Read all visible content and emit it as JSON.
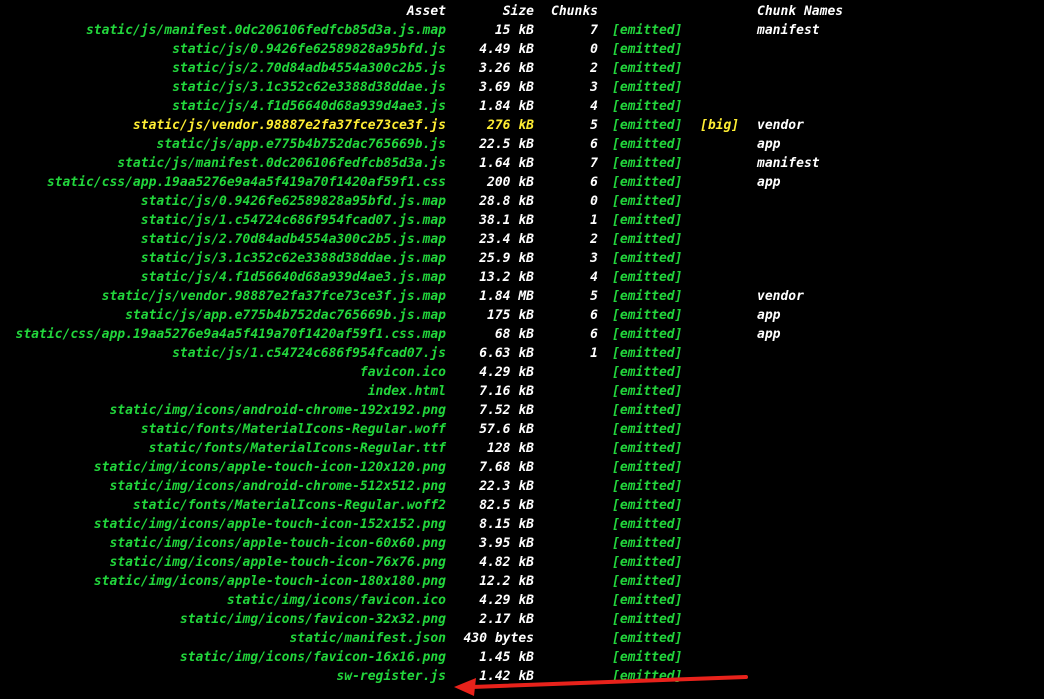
{
  "colors": {
    "background": "#000000",
    "asset_text": "#22d63c",
    "status_text": "#22d63c",
    "size_text": "#ffffff",
    "big_text": "#ffee33",
    "header_text": "#ffffff",
    "arrow": "#e8221b"
  },
  "header": {
    "asset": "Asset",
    "size": "Size",
    "chunks": "Chunks",
    "chunk_names": "Chunk Names"
  },
  "rows": [
    {
      "asset": "static/js/manifest.0dc206106fedfcb85d3a.js.map",
      "size": "15 kB",
      "chunks": "7",
      "status": "[emitted]",
      "flag": "",
      "chunk_names": "manifest"
    },
    {
      "asset": "static/js/0.9426fe62589828a95bfd.js",
      "size": "4.49 kB",
      "chunks": "0",
      "status": "[emitted]",
      "flag": "",
      "chunk_names": ""
    },
    {
      "asset": "static/js/2.70d84adb4554a300c2b5.js",
      "size": "3.26 kB",
      "chunks": "2",
      "status": "[emitted]",
      "flag": "",
      "chunk_names": ""
    },
    {
      "asset": "static/js/3.1c352c62e3388d38ddae.js",
      "size": "3.69 kB",
      "chunks": "3",
      "status": "[emitted]",
      "flag": "",
      "chunk_names": ""
    },
    {
      "asset": "static/js/4.f1d56640d68a939d4ae3.js",
      "size": "1.84 kB",
      "chunks": "4",
      "status": "[emitted]",
      "flag": "",
      "chunk_names": ""
    },
    {
      "asset": "static/js/vendor.98887e2fa37fce73ce3f.js",
      "size": "276 kB",
      "chunks": "5",
      "status": "[emitted]",
      "flag": "[big]",
      "chunk_names": "vendor",
      "big": true
    },
    {
      "asset": "static/js/app.e775b4b752dac765669b.js",
      "size": "22.5 kB",
      "chunks": "6",
      "status": "[emitted]",
      "flag": "",
      "chunk_names": "app"
    },
    {
      "asset": "static/js/manifest.0dc206106fedfcb85d3a.js",
      "size": "1.64 kB",
      "chunks": "7",
      "status": "[emitted]",
      "flag": "",
      "chunk_names": "manifest"
    },
    {
      "asset": "static/css/app.19aa5276e9a4a5f419a70f1420af59f1.css",
      "size": "200 kB",
      "chunks": "6",
      "status": "[emitted]",
      "flag": "",
      "chunk_names": "app"
    },
    {
      "asset": "static/js/0.9426fe62589828a95bfd.js.map",
      "size": "28.8 kB",
      "chunks": "0",
      "status": "[emitted]",
      "flag": "",
      "chunk_names": ""
    },
    {
      "asset": "static/js/1.c54724c686f954fcad07.js.map",
      "size": "38.1 kB",
      "chunks": "1",
      "status": "[emitted]",
      "flag": "",
      "chunk_names": ""
    },
    {
      "asset": "static/js/2.70d84adb4554a300c2b5.js.map",
      "size": "23.4 kB",
      "chunks": "2",
      "status": "[emitted]",
      "flag": "",
      "chunk_names": ""
    },
    {
      "asset": "static/js/3.1c352c62e3388d38ddae.js.map",
      "size": "25.9 kB",
      "chunks": "3",
      "status": "[emitted]",
      "flag": "",
      "chunk_names": ""
    },
    {
      "asset": "static/js/4.f1d56640d68a939d4ae3.js.map",
      "size": "13.2 kB",
      "chunks": "4",
      "status": "[emitted]",
      "flag": "",
      "chunk_names": ""
    },
    {
      "asset": "static/js/vendor.98887e2fa37fce73ce3f.js.map",
      "size": "1.84 MB",
      "chunks": "5",
      "status": "[emitted]",
      "flag": "",
      "chunk_names": "vendor"
    },
    {
      "asset": "static/js/app.e775b4b752dac765669b.js.map",
      "size": "175 kB",
      "chunks": "6",
      "status": "[emitted]",
      "flag": "",
      "chunk_names": "app"
    },
    {
      "asset": "static/css/app.19aa5276e9a4a5f419a70f1420af59f1.css.map",
      "size": "68 kB",
      "chunks": "6",
      "status": "[emitted]",
      "flag": "",
      "chunk_names": "app"
    },
    {
      "asset": "static/js/1.c54724c686f954fcad07.js",
      "size": "6.63 kB",
      "chunks": "1",
      "status": "[emitted]",
      "flag": "",
      "chunk_names": ""
    },
    {
      "asset": "favicon.ico",
      "size": "4.29 kB",
      "chunks": "",
      "status": "[emitted]",
      "flag": "",
      "chunk_names": ""
    },
    {
      "asset": "index.html",
      "size": "7.16 kB",
      "chunks": "",
      "status": "[emitted]",
      "flag": "",
      "chunk_names": ""
    },
    {
      "asset": "static/img/icons/android-chrome-192x192.png",
      "size": "7.52 kB",
      "chunks": "",
      "status": "[emitted]",
      "flag": "",
      "chunk_names": ""
    },
    {
      "asset": "static/fonts/MaterialIcons-Regular.woff",
      "size": "57.6 kB",
      "chunks": "",
      "status": "[emitted]",
      "flag": "",
      "chunk_names": ""
    },
    {
      "asset": "static/fonts/MaterialIcons-Regular.ttf",
      "size": "128 kB",
      "chunks": "",
      "status": "[emitted]",
      "flag": "",
      "chunk_names": ""
    },
    {
      "asset": "static/img/icons/apple-touch-icon-120x120.png",
      "size": "7.68 kB",
      "chunks": "",
      "status": "[emitted]",
      "flag": "",
      "chunk_names": ""
    },
    {
      "asset": "static/img/icons/android-chrome-512x512.png",
      "size": "22.3 kB",
      "chunks": "",
      "status": "[emitted]",
      "flag": "",
      "chunk_names": ""
    },
    {
      "asset": "static/fonts/MaterialIcons-Regular.woff2",
      "size": "82.5 kB",
      "chunks": "",
      "status": "[emitted]",
      "flag": "",
      "chunk_names": ""
    },
    {
      "asset": "static/img/icons/apple-touch-icon-152x152.png",
      "size": "8.15 kB",
      "chunks": "",
      "status": "[emitted]",
      "flag": "",
      "chunk_names": ""
    },
    {
      "asset": "static/img/icons/apple-touch-icon-60x60.png",
      "size": "3.95 kB",
      "chunks": "",
      "status": "[emitted]",
      "flag": "",
      "chunk_names": ""
    },
    {
      "asset": "static/img/icons/apple-touch-icon-76x76.png",
      "size": "4.82 kB",
      "chunks": "",
      "status": "[emitted]",
      "flag": "",
      "chunk_names": ""
    },
    {
      "asset": "static/img/icons/apple-touch-icon-180x180.png",
      "size": "12.2 kB",
      "chunks": "",
      "status": "[emitted]",
      "flag": "",
      "chunk_names": ""
    },
    {
      "asset": "static/img/icons/favicon.ico",
      "size": "4.29 kB",
      "chunks": "",
      "status": "[emitted]",
      "flag": "",
      "chunk_names": ""
    },
    {
      "asset": "static/img/icons/favicon-32x32.png",
      "size": "2.17 kB",
      "chunks": "",
      "status": "[emitted]",
      "flag": "",
      "chunk_names": ""
    },
    {
      "asset": "static/manifest.json",
      "size": "430 bytes",
      "chunks": "",
      "status": "[emitted]",
      "flag": "",
      "chunk_names": ""
    },
    {
      "asset": "static/img/icons/favicon-16x16.png",
      "size": "1.45 kB",
      "chunks": "",
      "status": "[emitted]",
      "flag": "",
      "chunk_names": ""
    },
    {
      "asset": "sw-register.js",
      "size": "1.42 kB",
      "chunks": "",
      "status": "[emitted]",
      "flag": "",
      "chunk_names": ""
    }
  ],
  "annotation": {
    "icon": "red-arrow-icon",
    "points_to": "sw-register.js"
  }
}
